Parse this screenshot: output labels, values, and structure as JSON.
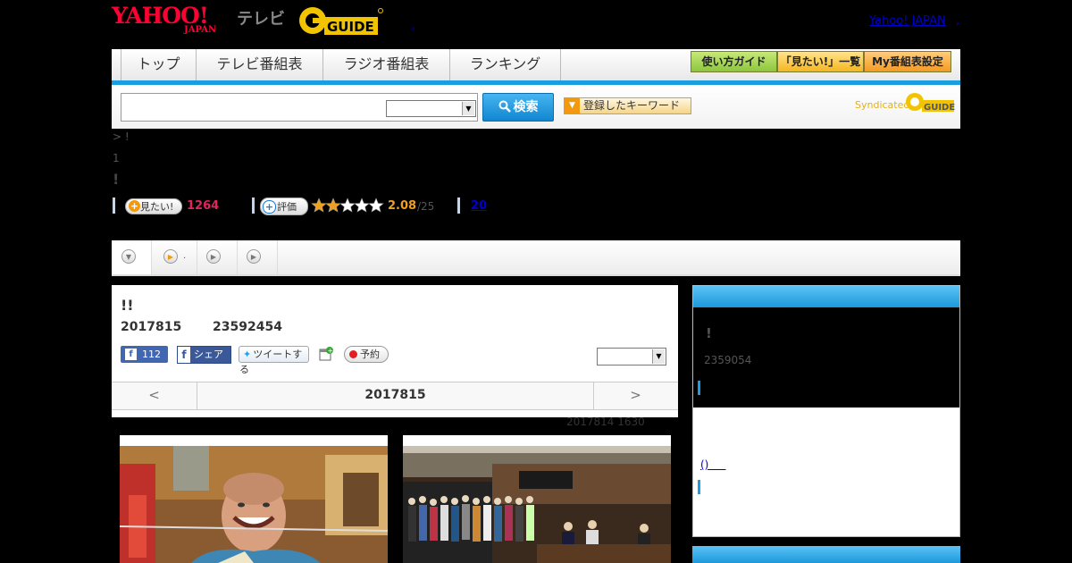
{
  "header": {
    "logo_yahoo": "YAHOO!",
    "logo_japan": "JAPAN",
    "logo_tv": "テレビ",
    "logo_guide": "GUIDE",
    "dot": ",",
    "yahoo_japan_link": "Yahoo! JAPAN",
    "trailing_comma": ","
  },
  "nav": {
    "tabs": [
      "トップ",
      "テレビ番組表",
      "ラジオ番組表",
      "ランキング"
    ],
    "buttons": [
      "使い方ガイド",
      "「見たい!」一覧",
      "My番組表設定"
    ]
  },
  "search": {
    "button_label": "検索",
    "keyword_button_label": "登録したキーワード",
    "syndicated": "Syndicated",
    "syndicated_logo": "GUIDE"
  },
  "breadcrumb": "> !",
  "line2": "1",
  "line3": "!",
  "stats": {
    "want_label": "見たい!",
    "want_count": "1264",
    "rating_label": "評価",
    "rating_value": "2.08",
    "rating_max": "/25",
    "rating_stars": 2,
    "comments_link": "20"
  },
  "tab_strip": {
    "tab2_label": "."
  },
  "program": {
    "title": "!!",
    "date": "2017815",
    "time": "23592454",
    "fb_like_count": "112",
    "fb_share_label": "シェア",
    "tweet_label": "ツイートする",
    "reserve_label": "予約",
    "date_nav_prev": "<",
    "date_nav_center": "2017815",
    "date_nav_next": ">",
    "updated": "2017814  1630"
  },
  "side": {
    "title": "!",
    "time": "2359054",
    "link": "()"
  },
  "colors": {
    "accent_blue": "#1a9ee0",
    "yahoo_red": "#ff0033",
    "want_pink": "#e0245e",
    "rating_orange": "#f0a020",
    "nav_button_green": "#8cc63f",
    "nav_button_orange": "#f5a623"
  }
}
